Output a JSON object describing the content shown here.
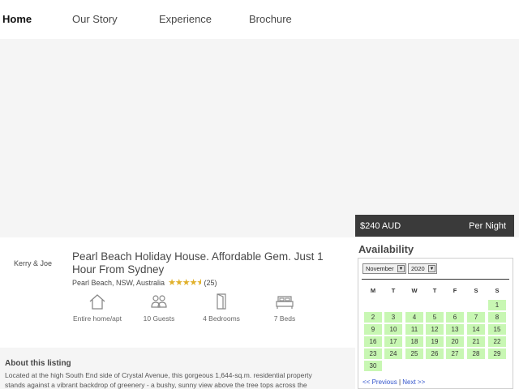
{
  "nav": {
    "items": [
      {
        "label": "Home",
        "active": true
      },
      {
        "label": "Our Story",
        "active": false
      },
      {
        "label": "Experience",
        "active": false
      },
      {
        "label": "Brochure",
        "active": false
      }
    ]
  },
  "price": {
    "amount": "$240 AUD",
    "per": "Per Night"
  },
  "host": {
    "name": "Kerry & Joe"
  },
  "listing": {
    "title": "Pearl Beach Holiday House. Affordable Gem. Just 1 Hour From Sydney",
    "location": "Pearl Beach, NSW, Australia",
    "rating": 4.5,
    "reviews": "(25)"
  },
  "amenities": [
    {
      "icon": "home-icon",
      "label": "Entire home/apt"
    },
    {
      "icon": "guests-icon",
      "label": "10 Guests"
    },
    {
      "icon": "door-icon",
      "label": "4 Bedrooms"
    },
    {
      "icon": "bed-icon",
      "label": "7 Beds"
    }
  ],
  "about": {
    "title": "About this listing",
    "text": "Located at the high South End side of Crystal Avenue, this gorgeous 1,644-sq.m. residential property stands against a vibrant backdrop of greenery - a bushy, sunny view above the tree tops across the"
  },
  "availability": {
    "title": "Availability",
    "month": "November",
    "year": "2020",
    "weekdays": [
      "M",
      "T",
      "W",
      "T",
      "F",
      "S",
      "S"
    ],
    "weeks": [
      [
        "",
        "",
        "",
        "",
        "",
        "",
        "1"
      ],
      [
        "2",
        "3",
        "4",
        "5",
        "6",
        "7",
        "8"
      ],
      [
        "9",
        "10",
        "11",
        "12",
        "13",
        "14",
        "15"
      ],
      [
        "16",
        "17",
        "18",
        "19",
        "20",
        "21",
        "22"
      ],
      [
        "23",
        "24",
        "25",
        "26",
        "27",
        "28",
        "29"
      ],
      [
        "30",
        "",
        "",
        "",
        "",
        "",
        ""
      ]
    ],
    "available_color": "#c8f7b3",
    "prev_label": "<< Previous",
    "separator": "|",
    "next_label": "Next >>"
  }
}
